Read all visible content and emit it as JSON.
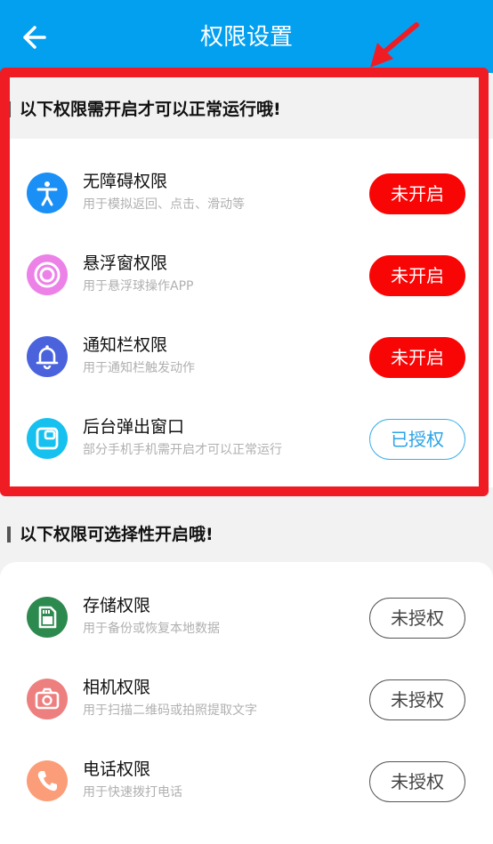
{
  "header": {
    "title": "权限设置"
  },
  "required_section": {
    "title": "以下权限需开启才可以正常运行哦!"
  },
  "required_items": [
    {
      "title": "无障碍权限",
      "subtitle": "用于模拟返回、点击、滑动等",
      "button": "未开启",
      "icon": "accessibility-icon"
    },
    {
      "title": "悬浮窗权限",
      "subtitle": "用于悬浮球操作APP",
      "button": "未开启",
      "icon": "floating-window-icon"
    },
    {
      "title": "通知栏权限",
      "subtitle": "用于通知栏触发动作",
      "button": "未开启",
      "icon": "bell-icon"
    },
    {
      "title": "后台弹出窗口",
      "subtitle": "部分手机手机需开启才可以正常运行",
      "button": "已授权",
      "icon": "popup-window-icon"
    }
  ],
  "optional_section": {
    "title": "以下权限可选择性开启哦!"
  },
  "optional_items": [
    {
      "title": "存储权限",
      "subtitle": "用于备份或恢复本地数据",
      "button": "未授权",
      "icon": "sd-card-icon"
    },
    {
      "title": "相机权限",
      "subtitle": "用于扫描二维码或拍照提取文字",
      "button": "未授权",
      "icon": "camera-icon"
    },
    {
      "title": "电话权限",
      "subtitle": "用于快速拨打电话",
      "button": "未授权",
      "icon": "phone-icon"
    }
  ],
  "colors": {
    "header": "#04a0f0",
    "button_off": "#f80606",
    "button_granted": "#2aa3e6",
    "highlight_frame": "#f01c24"
  }
}
